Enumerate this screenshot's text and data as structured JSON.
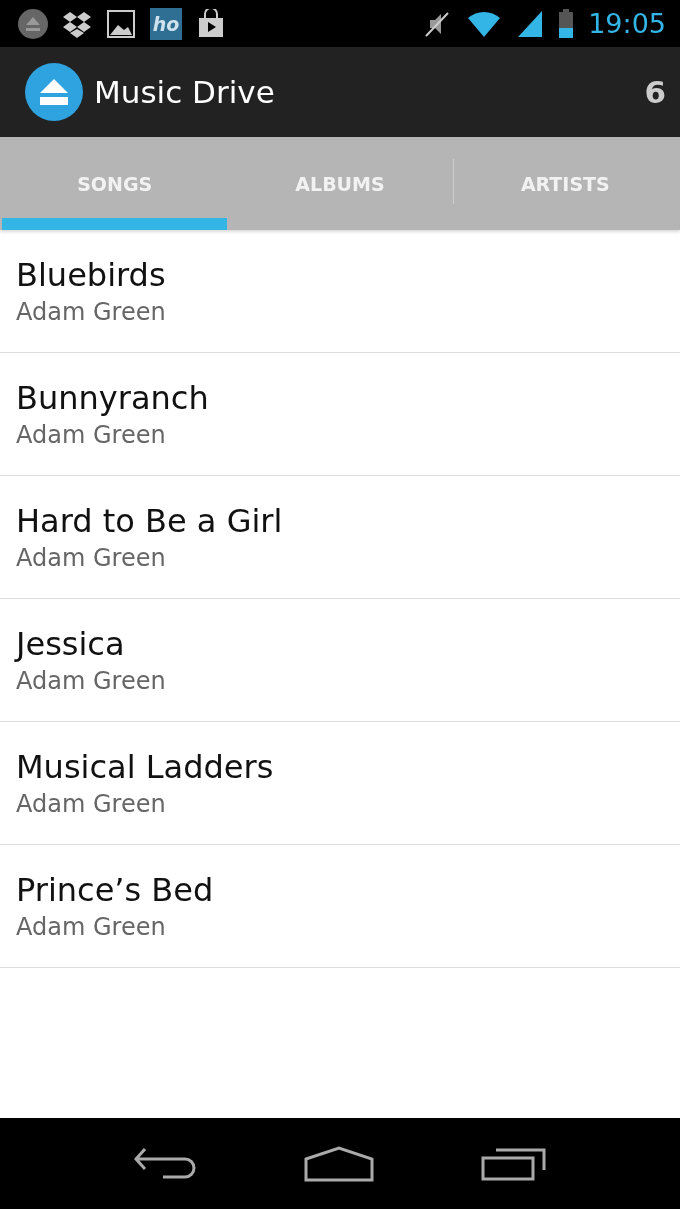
{
  "status_bar": {
    "app_icon_text": "ho",
    "time": "19:05"
  },
  "action_bar": {
    "title": "Music Drive",
    "count": "6"
  },
  "tabs": [
    {
      "label": "SONGS",
      "selected": true
    },
    {
      "label": "ALBUMS",
      "selected": false
    },
    {
      "label": "ARTISTS",
      "selected": false
    }
  ],
  "songs": [
    {
      "title": "Bluebirds",
      "artist": "Adam Green"
    },
    {
      "title": "Bunnyranch",
      "artist": "Adam Green"
    },
    {
      "title": "Hard to Be a Girl",
      "artist": "Adam Green"
    },
    {
      "title": "Jessica",
      "artist": "Adam Green"
    },
    {
      "title": "Musical Ladders",
      "artist": "Adam Green"
    },
    {
      "title": "Prince’s Bed",
      "artist": "Adam Green"
    }
  ]
}
